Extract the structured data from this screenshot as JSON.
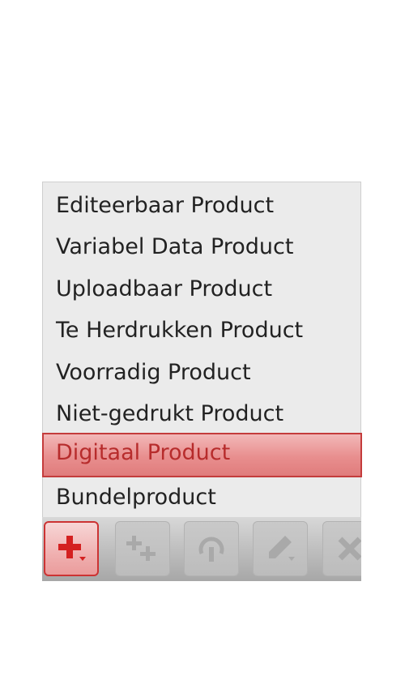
{
  "menu": {
    "items": [
      {
        "label": "Editeerbaar Product"
      },
      {
        "label": "Variabel Data Product"
      },
      {
        "label": "Uploadbaar Product"
      },
      {
        "label": "Te Herdrukken Product"
      },
      {
        "label": "Voorradig Product"
      },
      {
        "label": "Niet-gedrukt Product"
      },
      {
        "label": "Digitaal Product",
        "selected": true
      },
      {
        "label": "Bundelproduct"
      }
    ]
  },
  "toolbar": {
    "buttons": [
      {
        "icon": "add-dropdown-icon",
        "active": true
      },
      {
        "icon": "add-multiple-icon",
        "active": false
      },
      {
        "icon": "pin-icon",
        "active": false
      },
      {
        "icon": "edit-dropdown-icon",
        "active": false
      },
      {
        "icon": "delete-icon",
        "active": false
      }
    ]
  },
  "colors": {
    "accent": "#cc3333",
    "selected_text": "#b72c2c",
    "menu_bg": "#ebebeb",
    "disabled_icon": "#aaaaaa"
  }
}
